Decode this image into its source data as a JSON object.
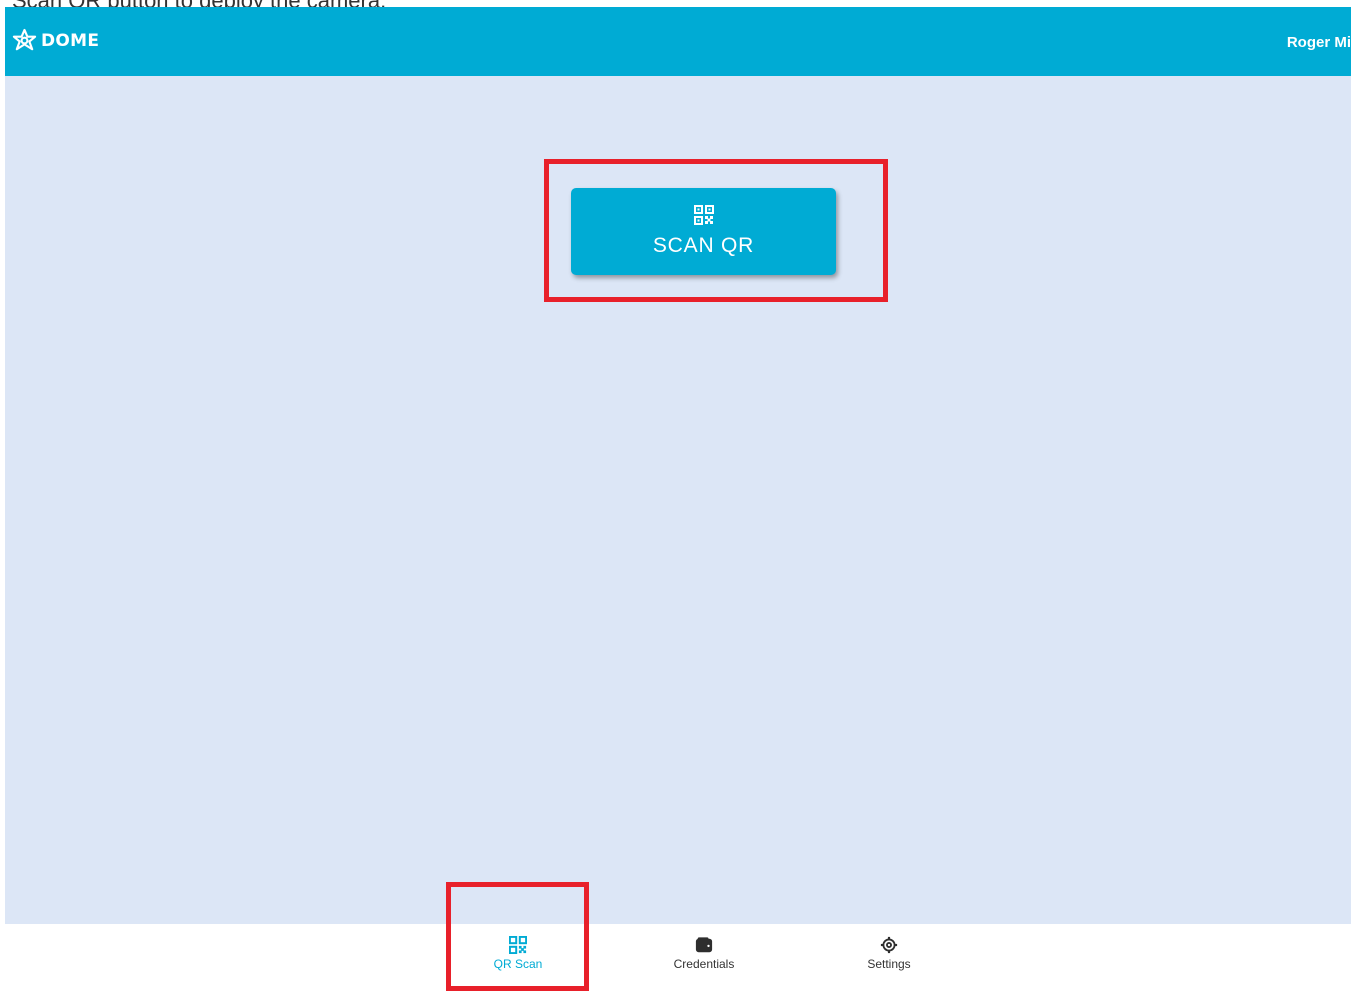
{
  "caption": "Scan QR button to deploy the camera.",
  "header": {
    "brand": "DOME",
    "user_name": "Roger Mi"
  },
  "main": {
    "scan_button_label": "SCAN QR"
  },
  "nav": {
    "items": [
      {
        "label": "QR Scan",
        "icon": "qr-code-icon",
        "active": true
      },
      {
        "label": "Credentials",
        "icon": "wallet-icon",
        "active": false
      },
      {
        "label": "Settings",
        "icon": "gear-icon",
        "active": false
      }
    ]
  },
  "colors": {
    "primary": "#00abd4",
    "content_background": "#dce6f6",
    "highlight": "#e8202a"
  }
}
